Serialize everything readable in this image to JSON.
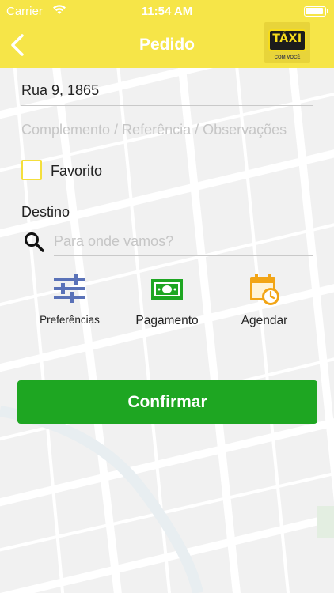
{
  "status_bar": {
    "carrier": "Carrier",
    "time": "11:54 AM",
    "icons": [
      "wifi-icon",
      "battery-icon"
    ]
  },
  "nav": {
    "title": "Pedido",
    "back_icon": "chevron-left-icon",
    "logo_text": "TÁXI",
    "logo_subtext": "COM VOCÊ"
  },
  "form": {
    "address_value": "Rua 9, 1865",
    "complement_placeholder": "Complemento / Referência / Observações",
    "favorite_label": "Favorito",
    "favorite_checked": false,
    "destination_label": "Destino",
    "destination_placeholder": "Para onde vamos?"
  },
  "options": [
    {
      "label": "Preferências",
      "icon": "sliders-icon"
    },
    {
      "label": "Pagamento",
      "icon": "cash-icon"
    },
    {
      "label": "Agendar",
      "icon": "calendar-clock-icon"
    }
  ],
  "confirm_label": "Confirmar",
  "colors": {
    "header": "#f6e548",
    "confirm": "#1ea622",
    "checkbox_border": "#f4df3c",
    "sliders_icon": "#5a72b8",
    "cash_icon": "#1ea622",
    "calendar_icon": "#f2a516"
  }
}
